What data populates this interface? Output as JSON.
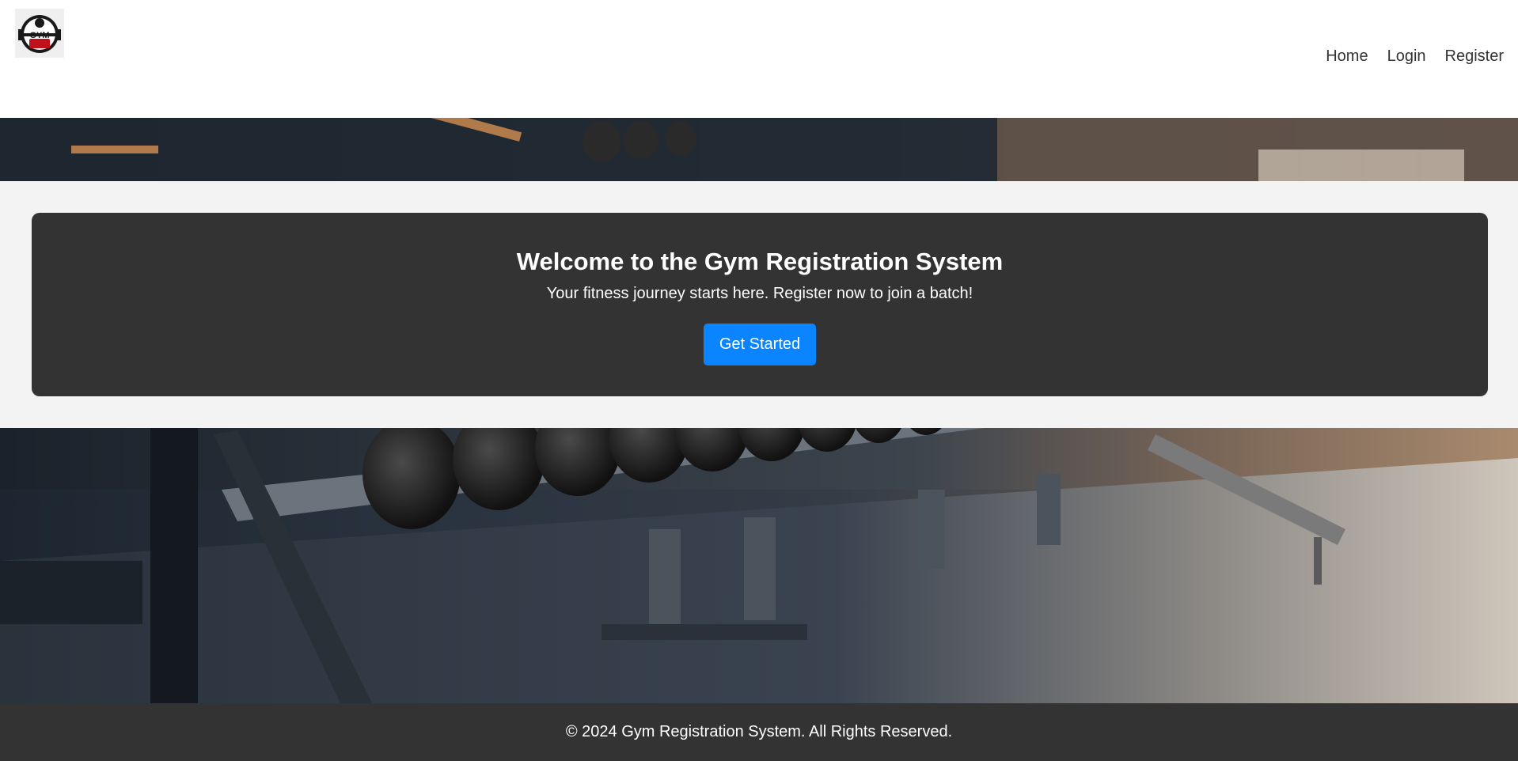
{
  "header": {
    "logo_text": "GYM",
    "nav": [
      {
        "label": "Home"
      },
      {
        "label": "Login"
      },
      {
        "label": "Register"
      }
    ]
  },
  "hero": {
    "title": "Welcome to the Gym Registration System",
    "subtitle": "Your fitness journey starts here. Register now to join a batch!",
    "cta_label": "Get Started"
  },
  "footer": {
    "text": "© 2024 Gym Registration System. All Rights Reserved."
  },
  "colors": {
    "card_bg": "#333333",
    "cta_bg": "#0a84ff",
    "footer_bg": "#333333"
  }
}
